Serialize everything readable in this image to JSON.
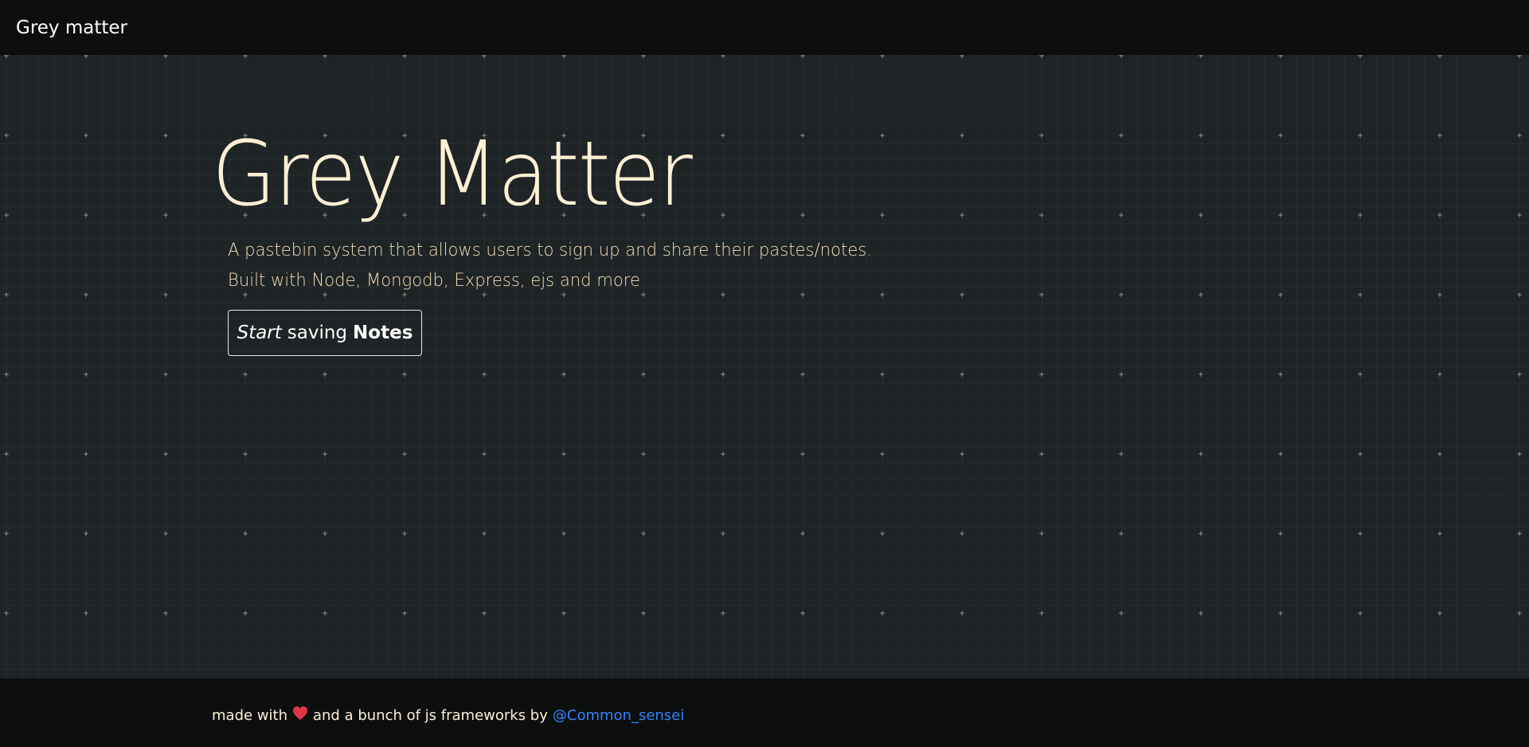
{
  "navbar": {
    "brand": "Grey matter"
  },
  "hero": {
    "title": "Grey Matter",
    "subtitle_line1": "A pastebin system that allows users to sign up and share their pastes/notes.",
    "subtitle_line2": "Built with Node, Mongodb, Express, ejs and more",
    "cta": {
      "word1": "Start",
      "word2": "saving",
      "word3": "Notes"
    }
  },
  "footer": {
    "prefix": "made with",
    "heart_icon": "heart-icon",
    "middle": "and a bunch of js frameworks by",
    "author": "@Common_sensei"
  },
  "colors": {
    "background": "#1e2325",
    "bar": "#0d0f0f",
    "title": "#fdf0d5",
    "heart": "#e0344a",
    "link": "#2f86ff"
  }
}
